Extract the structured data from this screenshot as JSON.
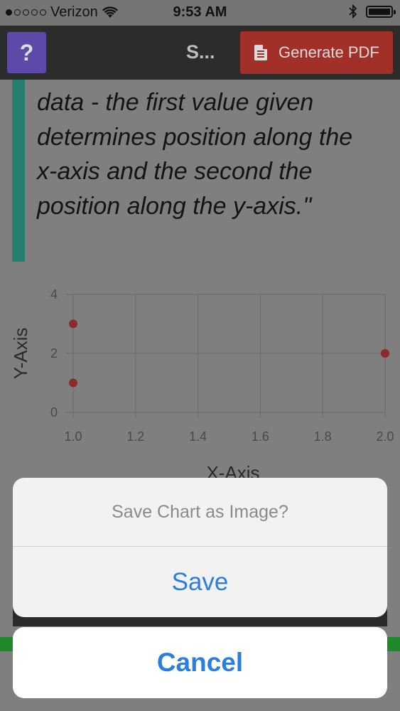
{
  "status_bar": {
    "carrier": "Verizon",
    "time": "9:53 AM"
  },
  "nav": {
    "help_label": "?",
    "title": "S...",
    "pdf_label": "Generate PDF"
  },
  "quote": "data - the first value given determines position along the x-axis and the second the position along the y-axis.\"",
  "chart_data": {
    "type": "scatter",
    "xlabel": "X-Axis",
    "ylabel": "Y-Axis",
    "xlim": [
      1.0,
      2.0
    ],
    "ylim": [
      0,
      4
    ],
    "x_ticks": [
      "1.0",
      "1.2",
      "1.4",
      "1.6",
      "1.8",
      "2.0"
    ],
    "y_ticks": [
      "0",
      "2",
      "4"
    ],
    "points": [
      {
        "x": 1.0,
        "y": 3
      },
      {
        "x": 1.0,
        "y": 1
      },
      {
        "x": 2.0,
        "y": 2
      }
    ],
    "point_color": "#8b2a2a"
  },
  "sheet": {
    "title": "Save Chart as Image?",
    "save_label": "Save",
    "cancel_label": "Cancel"
  },
  "colors": {
    "accent": "#2a7fde",
    "help": "#5d49a8",
    "pdf": "#a23028",
    "quote_bar": "#27806f"
  }
}
